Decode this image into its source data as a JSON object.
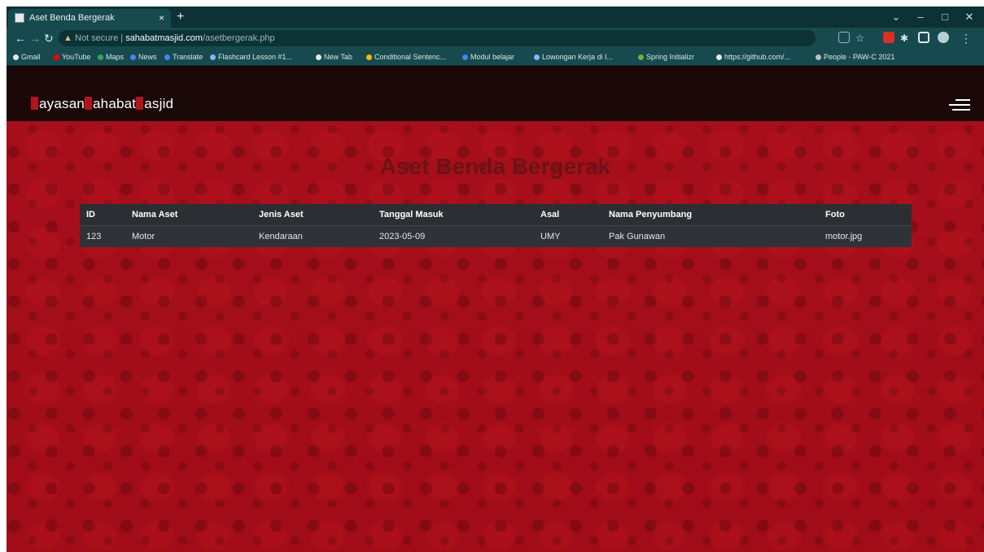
{
  "browser": {
    "tab_title": "Aset Benda Bergerak",
    "tab_close": "×",
    "new_tab": "+",
    "window_controls": {
      "minimize": "–",
      "maximize": "□",
      "close": "✕",
      "tab_search": "⌄"
    },
    "url_security": "Not secure",
    "url_host": "sahabatmasjid.com",
    "url_path": "/asetbergerak.php",
    "bookmarks": [
      "Gmail",
      "YouTube",
      "Maps",
      "News",
      "Translate",
      "Flashcard Lesson #1...",
      "New Tab",
      "Conditional Sentenc...",
      "Modul belajar",
      "Lowongan Kerja di I...",
      "Spring Initializr",
      "https://github.com/...",
      "People - PAW-C 2021"
    ]
  },
  "site": {
    "brand": "YayasanSahabatMasjid",
    "brand_parts": [
      {
        "rest": "ayasan"
      },
      {
        "rest": "ahabat"
      },
      {
        "rest": "asjid"
      }
    ],
    "heading": "Aset Benda Bergerak"
  },
  "table": {
    "headers": [
      "ID",
      "Nama Aset",
      "Jenis Aset",
      "Tanggal Masuk",
      "Asal",
      "Nama Penyumbang",
      "Foto"
    ],
    "rows": [
      [
        "123",
        "Motor",
        "Kendaraan",
        "2023-05-09",
        "UMY",
        "Pak Gunawan",
        "motor.jpg"
      ]
    ]
  },
  "colors": {
    "page_background": "#a30d18",
    "navbar": "#1a0707",
    "heading": "#6a1416",
    "table_background": "#2b2f33",
    "brand_accent": "#b3141f",
    "browser_frame": "#174a4f"
  },
  "icons": [
    "back-icon",
    "forward-icon",
    "reload-icon",
    "lock-warning-icon",
    "share-icon",
    "star-icon",
    "extension-icon",
    "puzzle-icon",
    "sidebar-icon",
    "profile-icon",
    "menu-dots-icon",
    "hamburger-icon"
  ]
}
